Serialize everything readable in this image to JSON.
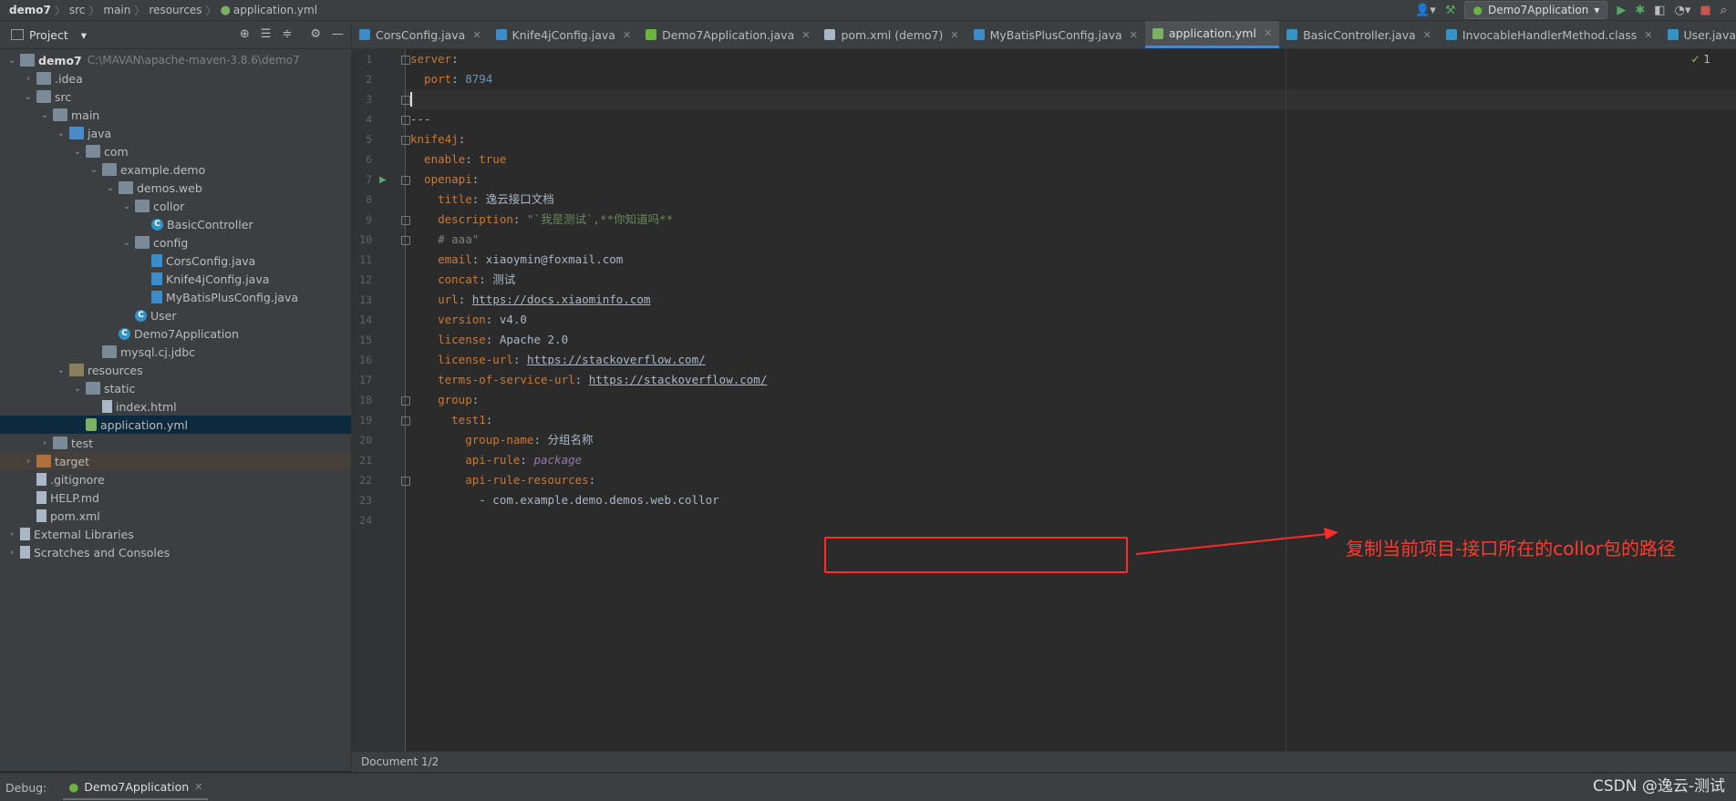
{
  "breadcrumb": {
    "items": [
      "demo7",
      "src",
      "main",
      "resources",
      "application.yml"
    ]
  },
  "run_config": {
    "label": "Demo7Application"
  },
  "project_panel": {
    "title": "Project",
    "tree": [
      {
        "label": "demo7",
        "path": "C:\\MAVAN\\apache-maven-3.8.6\\demo7",
        "depth": 0,
        "icon": "module-folder-icon",
        "expanded": true
      },
      {
        "label": ".idea",
        "depth": 1,
        "icon": "folder-icon",
        "expanded": false
      },
      {
        "label": "src",
        "depth": 1,
        "icon": "folder-icon",
        "expanded": true
      },
      {
        "label": "main",
        "depth": 2,
        "icon": "folder-icon",
        "expanded": true
      },
      {
        "label": "java",
        "depth": 3,
        "icon": "source-folder-icon",
        "expanded": true
      },
      {
        "label": "com",
        "depth": 4,
        "icon": "package-icon",
        "expanded": true
      },
      {
        "label": "example.demo",
        "depth": 5,
        "icon": "package-icon",
        "expanded": true
      },
      {
        "label": "demos.web",
        "depth": 6,
        "icon": "package-icon",
        "expanded": true
      },
      {
        "label": "collor",
        "depth": 7,
        "icon": "package-icon",
        "expanded": true
      },
      {
        "label": "BasicController",
        "depth": 8,
        "icon": "class-icon"
      },
      {
        "label": "config",
        "depth": 7,
        "icon": "package-icon",
        "expanded": true
      },
      {
        "label": "CorsConfig.java",
        "depth": 8,
        "icon": "java-file-icon"
      },
      {
        "label": "Knife4jConfig.java",
        "depth": 8,
        "icon": "java-file-icon"
      },
      {
        "label": "MyBatisPlusConfig.java",
        "depth": 8,
        "icon": "java-file-icon"
      },
      {
        "label": "User",
        "depth": 7,
        "icon": "class-icon"
      },
      {
        "label": "Demo7Application",
        "depth": 6,
        "icon": "spring-class-icon"
      },
      {
        "label": "mysql.cj.jdbc",
        "depth": 5,
        "icon": "package-icon"
      },
      {
        "label": "resources",
        "depth": 3,
        "icon": "resources-folder-icon",
        "expanded": true
      },
      {
        "label": "static",
        "depth": 4,
        "icon": "folder-icon",
        "expanded": true
      },
      {
        "label": "index.html",
        "depth": 5,
        "icon": "html-file-icon"
      },
      {
        "label": "application.yml",
        "depth": 4,
        "icon": "yml-file-icon",
        "selected": true
      },
      {
        "label": "test",
        "depth": 2,
        "icon": "folder-icon",
        "expanded": false
      },
      {
        "label": "target",
        "depth": 1,
        "icon": "excluded-folder-icon",
        "expanded": false
      },
      {
        "label": ".gitignore",
        "depth": 1,
        "icon": "file-icon"
      },
      {
        "label": "HELP.md",
        "depth": 1,
        "icon": "markdown-file-icon"
      },
      {
        "label": "pom.xml",
        "depth": 1,
        "icon": "maven-file-icon"
      },
      {
        "label": "External Libraries",
        "depth": 0,
        "icon": "libraries-icon",
        "expanded": false
      },
      {
        "label": "Scratches and Consoles",
        "depth": 0,
        "icon": "scratches-icon",
        "expanded": false
      }
    ]
  },
  "tabs": [
    {
      "label": "CorsConfig.java",
      "icon": "java-file-icon"
    },
    {
      "label": "Knife4jConfig.java",
      "icon": "java-file-icon"
    },
    {
      "label": "Demo7Application.java",
      "icon": "spring-class-icon"
    },
    {
      "label": "pom.xml (demo7)",
      "icon": "maven-file-icon"
    },
    {
      "label": "MyBatisPlusConfig.java",
      "icon": "java-file-icon"
    },
    {
      "label": "application.yml",
      "icon": "yml-file-icon",
      "active": true
    },
    {
      "label": "BasicController.java",
      "icon": "class-icon"
    },
    {
      "label": "InvocableHandlerMethod.class",
      "icon": "class-icon"
    },
    {
      "label": "User.java",
      "icon": "class-icon"
    }
  ],
  "editor": {
    "inspection_count": "1",
    "lines": [
      [
        {
          "t": "server",
          "c": "k"
        },
        {
          "t": ":",
          "c": ""
        }
      ],
      [
        {
          "t": "  port",
          "c": "k"
        },
        {
          "t": ": ",
          "c": ""
        },
        {
          "t": "8794",
          "c": "n"
        }
      ],
      [],
      [
        {
          "t": "---",
          "c": ""
        }
      ],
      [
        {
          "t": "knife4j",
          "c": "k"
        },
        {
          "t": ":",
          "c": ""
        }
      ],
      [
        {
          "t": "  enable",
          "c": "k"
        },
        {
          "t": ": ",
          "c": ""
        },
        {
          "t": "true",
          "c": "k"
        }
      ],
      [
        {
          "t": "  openapi",
          "c": "k"
        },
        {
          "t": ":",
          "c": ""
        }
      ],
      [
        {
          "t": "    title",
          "c": "k"
        },
        {
          "t": ": 逸云接口文档",
          "c": ""
        }
      ],
      [
        {
          "t": "    description",
          "c": "k"
        },
        {
          "t": ": ",
          "c": ""
        },
        {
          "t": "\"`我是测试`,**你知道吗**",
          "c": "s"
        }
      ],
      [
        {
          "t": "    # aaa\"",
          "c": "c"
        }
      ],
      [
        {
          "t": "    email",
          "c": "k"
        },
        {
          "t": ": xiaoymin@foxmail.com",
          "c": ""
        }
      ],
      [
        {
          "t": "    concat",
          "c": "k"
        },
        {
          "t": ": 测试",
          "c": ""
        }
      ],
      [
        {
          "t": "    url",
          "c": "k"
        },
        {
          "t": ": ",
          "c": ""
        },
        {
          "t": "https://docs.xiaominfo.com",
          "c": "u"
        }
      ],
      [
        {
          "t": "    version",
          "c": "k"
        },
        {
          "t": ": v4.0",
          "c": ""
        }
      ],
      [
        {
          "t": "    license",
          "c": "k"
        },
        {
          "t": ": Apache 2.0",
          "c": ""
        }
      ],
      [
        {
          "t": "    license-url",
          "c": "k"
        },
        {
          "t": ": ",
          "c": ""
        },
        {
          "t": "https://stackoverflow.com/",
          "c": "u"
        }
      ],
      [
        {
          "t": "    terms-of-service-url",
          "c": "k"
        },
        {
          "t": ": ",
          "c": ""
        },
        {
          "t": "https://stackoverflow.com/",
          "c": "u"
        }
      ],
      [
        {
          "t": "    group",
          "c": "k"
        },
        {
          "t": ":",
          "c": ""
        }
      ],
      [
        {
          "t": "      test1",
          "c": "k"
        },
        {
          "t": ":",
          "c": ""
        }
      ],
      [
        {
          "t": "        group-name",
          "c": "k"
        },
        {
          "t": ": 分组名称",
          "c": ""
        }
      ],
      [
        {
          "t": "        api-rule",
          "c": "k"
        },
        {
          "t": ": ",
          "c": ""
        },
        {
          "t": "package",
          "c": "it"
        }
      ],
      [
        {
          "t": "        api-rule-resources",
          "c": "k"
        },
        {
          "t": ":",
          "c": ""
        }
      ],
      [
        {
          "t": "          - com.example.demo.demos.web.collor",
          "c": ""
        }
      ],
      []
    ]
  },
  "annotation": {
    "text": "复制当前项目-接口所在的collor包的路径",
    "color": "#ff3a2e"
  },
  "status": {
    "document": "Document 1/2"
  },
  "debug_bar": {
    "label": "Debug:",
    "tab": "Demo7Application"
  },
  "watermark": "CSDN @逸云-测试"
}
